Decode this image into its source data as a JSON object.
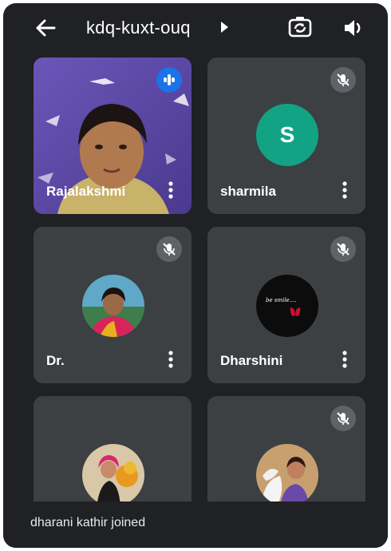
{
  "header": {
    "meeting_code": "kdq-kuxt-ouq",
    "back_icon": "arrow-left-icon",
    "camera_switch_icon": "camera-switch-icon",
    "audio_icon": "speaker-icon"
  },
  "participants": [
    {
      "name": "Rajalakshmi",
      "type": "video",
      "muted": false,
      "speaking": true
    },
    {
      "name": "sharmila",
      "type": "initial-avatar",
      "initial": "S",
      "avatar_color": "#12a385",
      "muted": true
    },
    {
      "name": "Dr.",
      "type": "photo-avatar",
      "muted": true
    },
    {
      "name": "Dharshini",
      "type": "photo-avatar",
      "avatar_text": "be smile....",
      "muted": true
    },
    {
      "name": "",
      "type": "photo-avatar",
      "muted": false
    },
    {
      "name": "",
      "type": "photo-avatar",
      "muted": true
    }
  ],
  "toast": {
    "message": "dharani kathir joined"
  },
  "colors": {
    "background": "#202124",
    "tile": "#3c4043",
    "speaking_indicator": "#1a73e8",
    "mute_badge": "#5f6368"
  }
}
